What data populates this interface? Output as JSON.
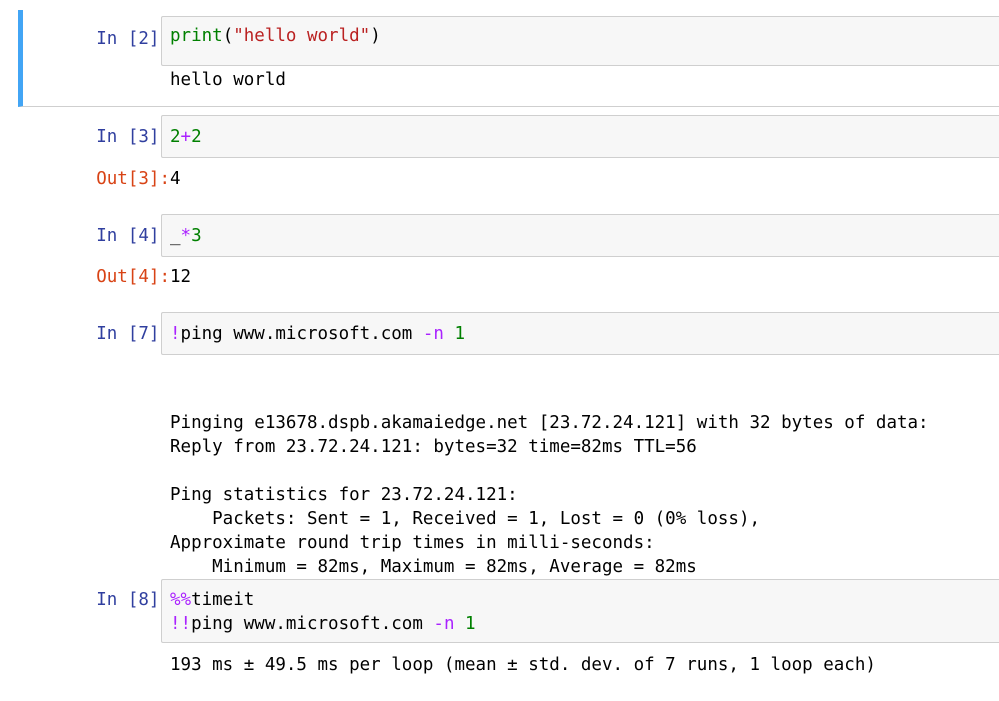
{
  "colors": {
    "selection_bar": "#42a5f5",
    "in_prompt": "#303f9f",
    "out_prompt": "#d84315",
    "input_bg": "#f7f7f7",
    "keyword_green": "#008000",
    "string_red": "#ba2121",
    "operator_purple": "#aa22ff"
  },
  "cells": [
    {
      "prompt": "In [2]:",
      "code": {
        "fn": "print",
        "open": "(",
        "str": "\"hello world\"",
        "close": ")"
      },
      "output": "hello world"
    },
    {
      "prompt": "In [3]:",
      "code": {
        "a": "2",
        "op": "+",
        "b": "2"
      },
      "out_prompt": "Out[3]:",
      "output": "4"
    },
    {
      "prompt": "In [4]:",
      "code": {
        "a": "_",
        "op": "*",
        "b": "3"
      },
      "out_prompt": "Out[4]:",
      "output": "12"
    },
    {
      "prompt": "In [7]:",
      "code": {
        "bang": "!",
        "cmd": "ping www.microsoft.com ",
        "flag": "-n",
        "sp": " ",
        "num": "1"
      },
      "output_lines": [
        "Pinging e13678.dspb.akamaiedge.net [23.72.24.121] with 32 bytes of data:",
        "Reply from 23.72.24.121: bytes=32 time=82ms TTL=56",
        "",
        "Ping statistics for 23.72.24.121:",
        "    Packets: Sent = 1, Received = 1, Lost = 0 (0% loss),",
        "Approximate round trip times in milli-seconds:",
        "    Minimum = 82ms, Maximum = 82ms, Average = 82ms"
      ]
    },
    {
      "prompt": "In [8]:",
      "code": {
        "line1_magic": "%%",
        "line1_rest": "timeit",
        "line2_bang": "!!",
        "line2_cmd": "ping www.microsoft.com ",
        "line2_flag": "-n",
        "line2_sp": " ",
        "line2_num": "1"
      },
      "output": "193 ms ± 49.5 ms per loop (mean ± std. dev. of 7 runs, 1 loop each)"
    }
  ]
}
